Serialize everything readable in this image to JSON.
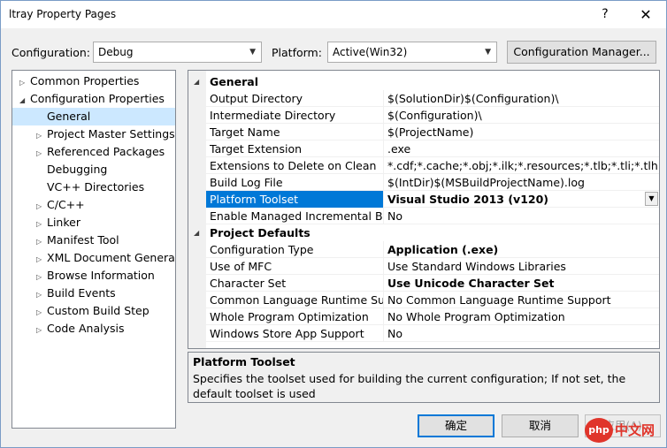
{
  "window": {
    "title": "ltray Property Pages",
    "help_glyph": "?",
    "close_glyph": "✕"
  },
  "config_bar": {
    "configuration_label": "Configuration:",
    "configuration_value": "Debug",
    "platform_label": "Platform:",
    "platform_value": "Active(Win32)",
    "manager_button": "Configuration Manager..."
  },
  "tree": {
    "items": [
      {
        "label": "Common Properties",
        "expander": "▷",
        "level": 0
      },
      {
        "label": "Configuration Properties",
        "expander": "◢",
        "level": 0
      },
      {
        "label": "General",
        "expander": "",
        "level": 1,
        "selected": true
      },
      {
        "label": "Project Master Settings",
        "expander": "▷",
        "level": 1
      },
      {
        "label": "Referenced Packages",
        "expander": "▷",
        "level": 1
      },
      {
        "label": "Debugging",
        "expander": "",
        "level": 1
      },
      {
        "label": "VC++ Directories",
        "expander": "",
        "level": 1
      },
      {
        "label": "C/C++",
        "expander": "▷",
        "level": 1
      },
      {
        "label": "Linker",
        "expander": "▷",
        "level": 1
      },
      {
        "label": "Manifest Tool",
        "expander": "▷",
        "level": 1
      },
      {
        "label": "XML Document Generat",
        "expander": "▷",
        "level": 1
      },
      {
        "label": "Browse Information",
        "expander": "▷",
        "level": 1
      },
      {
        "label": "Build Events",
        "expander": "▷",
        "level": 1
      },
      {
        "label": "Custom Build Step",
        "expander": "▷",
        "level": 1
      },
      {
        "label": "Code Analysis",
        "expander": "▷",
        "level": 1
      }
    ]
  },
  "grid": {
    "categories": [
      {
        "label": "General",
        "expander": "◢",
        "rows": [
          {
            "name": "Output Directory",
            "value": "$(SolutionDir)$(Configuration)\\"
          },
          {
            "name": "Intermediate Directory",
            "value": "$(Configuration)\\"
          },
          {
            "name": "Target Name",
            "value": "$(ProjectName)"
          },
          {
            "name": "Target Extension",
            "value": ".exe"
          },
          {
            "name": "Extensions to Delete on Clean",
            "value": "*.cdf;*.cache;*.obj;*.ilk;*.resources;*.tlb;*.tli;*.tlh;*.tmp;*"
          },
          {
            "name": "Build Log File",
            "value": "$(IntDir)$(MSBuildProjectName).log"
          },
          {
            "name": "Platform Toolset",
            "value": "Visual Studio 2013 (v120)",
            "selected": true,
            "bold": true
          },
          {
            "name": "Enable Managed Incremental Buil",
            "value": "No"
          }
        ]
      },
      {
        "label": "Project Defaults",
        "expander": "◢",
        "rows": [
          {
            "name": "Configuration Type",
            "value": "Application (.exe)",
            "bold": true
          },
          {
            "name": "Use of MFC",
            "value": "Use Standard Windows Libraries"
          },
          {
            "name": "Character Set",
            "value": "Use Unicode Character Set",
            "bold": true
          },
          {
            "name": "Common Language Runtime Supp",
            "value": "No Common Language Runtime Support"
          },
          {
            "name": "Whole Program Optimization",
            "value": "No Whole Program Optimization"
          },
          {
            "name": "Windows Store App Support",
            "value": "No"
          }
        ]
      }
    ]
  },
  "description": {
    "title": "Platform Toolset",
    "text": "Specifies the toolset used for building the current configuration; If not set, the default toolset is used"
  },
  "buttons": {
    "ok": "确定",
    "cancel": "取消",
    "apply": "应用(A)"
  },
  "watermark": {
    "logo_text": "php",
    "text": "中文网"
  }
}
